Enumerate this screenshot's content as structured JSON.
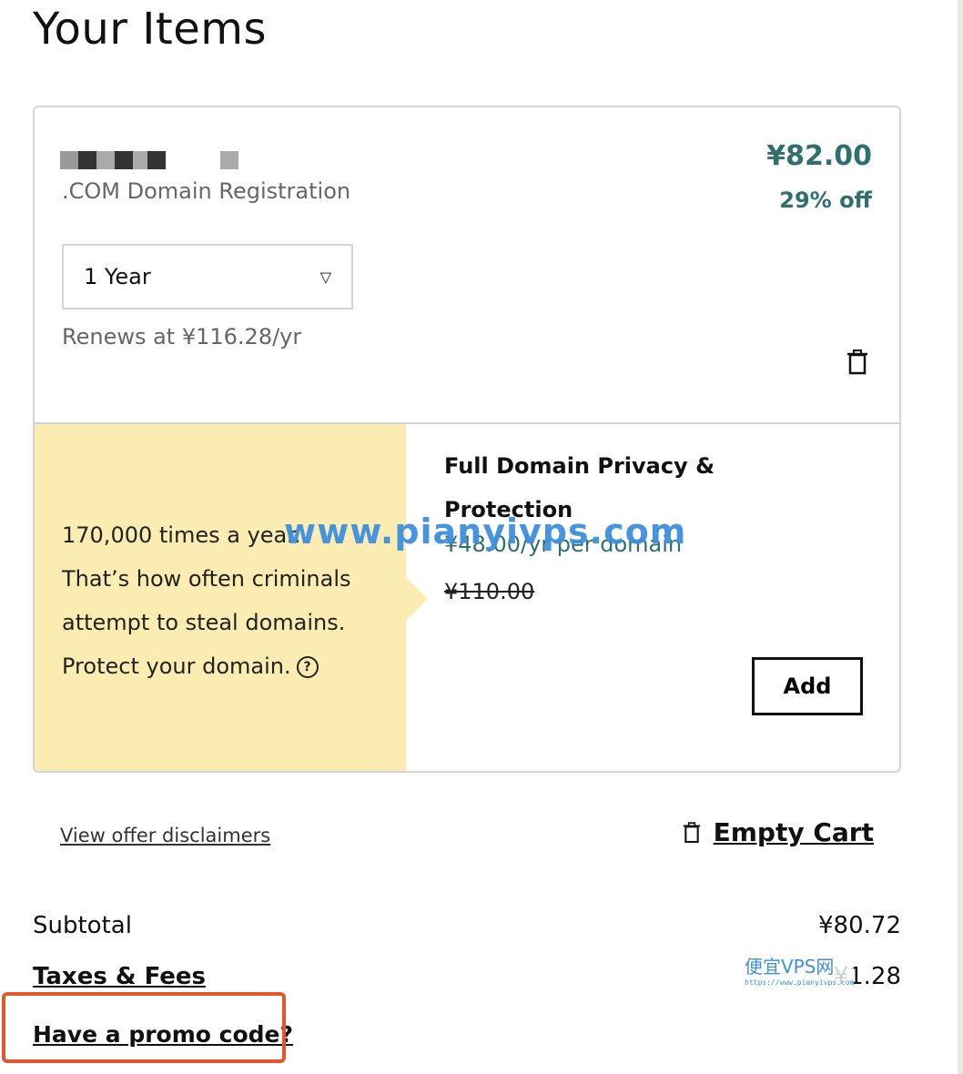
{
  "page": {
    "title": "Your Items"
  },
  "item": {
    "product": ".COM Domain Registration",
    "price": "¥82.00",
    "discount": "29% off",
    "term": "1 Year",
    "renews": "Renews at ¥116.28/yr"
  },
  "addon": {
    "promo_lines": [
      "170,000 times a year.",
      "That’s how often criminals",
      "attempt to steal domains.",
      "Protect your domain."
    ],
    "title": "Full Domain Privacy & Protection",
    "price": "¥48.00/yr per domain",
    "old_price": "¥110.00",
    "add_label": "Add"
  },
  "links": {
    "disclaimers": "View offer disclaimers",
    "empty_cart": "Empty Cart",
    "promo_code": "Have a promo code?"
  },
  "summary": {
    "subtotal_label": "Subtotal",
    "subtotal": "¥80.72",
    "taxes_label": "Taxes & Fees",
    "taxes": "¥1.28"
  },
  "watermark": {
    "main": "www.pianyivps.com",
    "cn": "便宜VPS网",
    "url": "https://www.pianyivps.com"
  },
  "colors": {
    "accent": "#2f6f6e",
    "promo_bg": "#fbedb2",
    "highlight": "#e3552b"
  }
}
